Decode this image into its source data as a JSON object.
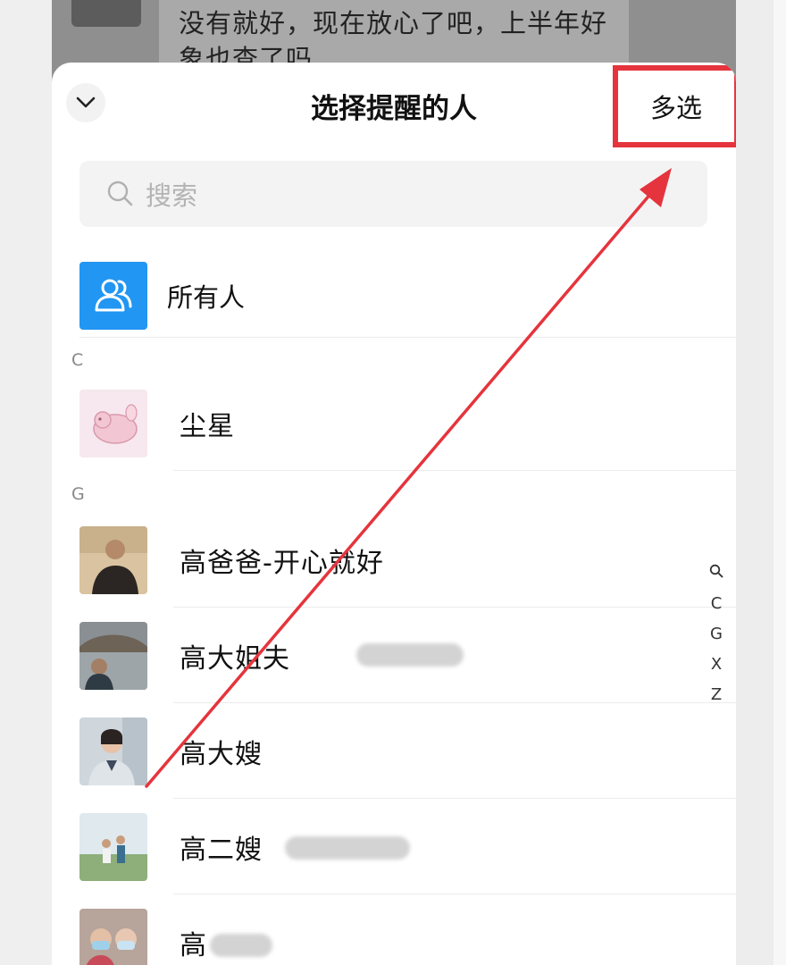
{
  "background_chat": {
    "message_text": "没有就好，现在放心了吧，上半年好象也查了吗"
  },
  "sheet": {
    "title": "选择提醒的人",
    "multi_select_label": "多选",
    "collapse_icon": "chevron-down-icon"
  },
  "search": {
    "placeholder": "搜索",
    "icon": "search-icon"
  },
  "everyone": {
    "label": "所有人",
    "icon": "group-icon",
    "color": "#2196f3"
  },
  "sections": [
    {
      "letter": "C",
      "contacts": [
        {
          "name": "尘星"
        }
      ]
    },
    {
      "letter": "G",
      "contacts": [
        {
          "name": "高爸爸-开心就好"
        },
        {
          "name": "高大姐夫"
        },
        {
          "name": "高大嫂"
        },
        {
          "name": "高二嫂"
        },
        {
          "name": "高"
        }
      ]
    }
  ],
  "index_bar": [
    "search-icon",
    "C",
    "G",
    "X",
    "Z"
  ],
  "annotation": {
    "highlight_color": "#e5343d"
  }
}
